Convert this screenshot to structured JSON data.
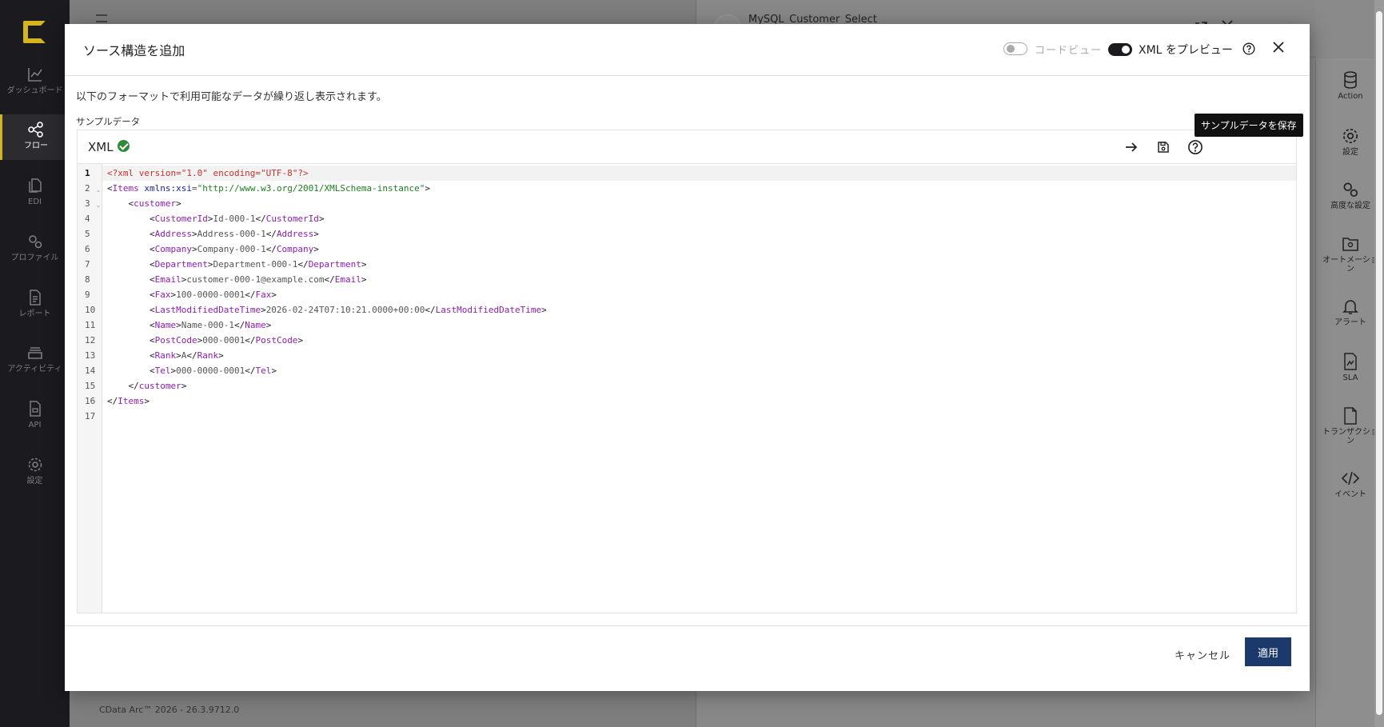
{
  "nav": {
    "items": [
      {
        "label": "ダッシュボード",
        "icon": "chart-line-icon"
      },
      {
        "label": "フロー",
        "icon": "share-nodes-icon",
        "active": true
      },
      {
        "label": "EDI",
        "icon": "documents-icon"
      },
      {
        "label": "プロファイル",
        "icon": "gears-icon"
      },
      {
        "label": "レポート",
        "icon": "report-icon"
      },
      {
        "label": "アクティビティ",
        "icon": "stack-icon"
      },
      {
        "label": "API",
        "icon": "api-doc-icon"
      },
      {
        "label": "設定",
        "icon": "gear-icon"
      }
    ]
  },
  "background": {
    "connector_title": "MySQL_Customer_Select",
    "version": "CData Arc™ 2026 - 26.3.9712.0"
  },
  "right_panel": {
    "items": [
      {
        "label": "Action",
        "icon": "database-icon"
      },
      {
        "label": "設定",
        "icon": "gear-icon"
      },
      {
        "label": "高度な設定",
        "icon": "gears-icon"
      },
      {
        "label": "オートメーション",
        "icon": "folder-gear-icon"
      },
      {
        "label": "アラート",
        "icon": "bell-icon"
      },
      {
        "label": "SLA",
        "icon": "sla-doc-icon"
      },
      {
        "label": "トランザクション",
        "icon": "document-icon"
      },
      {
        "label": "イベント",
        "icon": "code-icon"
      }
    ]
  },
  "modal": {
    "title": "ソース構造を追加",
    "code_view_label": "コードビュー",
    "xml_preview_label": "XML をプレビュー",
    "description": "以下のフォーマットで利用可能なデータが繰り返し表示されます。",
    "sample_label": "サンプルデータ",
    "format": "XML",
    "tooltip": "サンプルデータを保存",
    "cancel_label": "キャンセル",
    "apply_label": "適用"
  },
  "code_lines": [
    "<?xml version=\"1.0\" encoding=\"UTF-8\"?>",
    "<Items xmlns:xsi=\"http://www.w3.org/2001/XMLSchema-instance\">",
    "    <customer>",
    "        <CustomerId>Id-000-1</CustomerId>",
    "        <Address>Address-000-1</Address>",
    "        <Company>Company-000-1</Company>",
    "        <Department>Department-000-1</Department>",
    "        <Email>customer-000-1@example.com</Email>",
    "        <Fax>100-0000-0001</Fax>",
    "        <LastModifiedDateTime>2026-02-24T07:10:21.0000+00:00</LastModifiedDateTime>",
    "        <Name>Name-000-1</Name>",
    "        <PostCode>000-0001</PostCode>",
    "        <Rank>A</Rank>",
    "        <Tel>000-0000-0001</Tel>",
    "    </customer>",
    "</Items>",
    ""
  ],
  "colors": {
    "accent": "#d5b51f",
    "apply_button": "#1b3a6b",
    "valid_check": "#2e8b3a",
    "xml_tag": "#8e1db3",
    "xml_decl": "#c2342c"
  }
}
